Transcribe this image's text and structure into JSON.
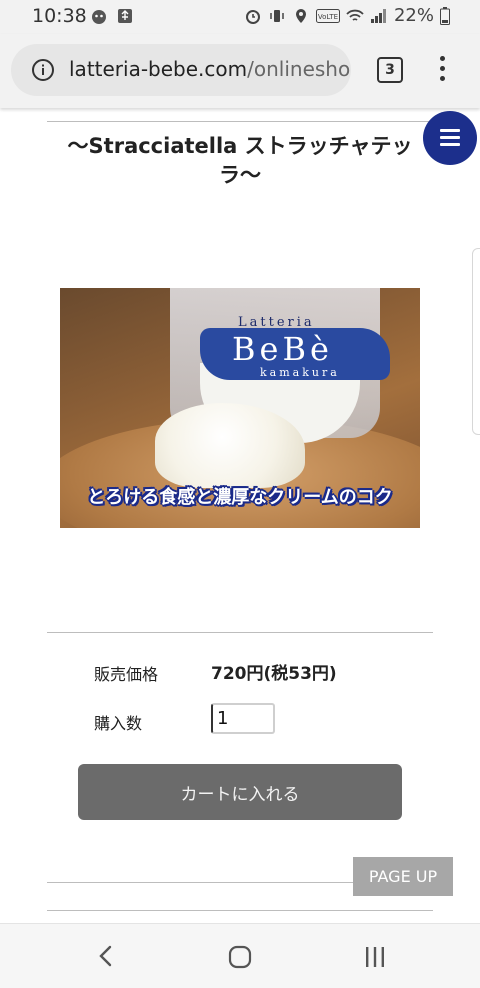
{
  "status_bar": {
    "time": "10:38",
    "battery": "22%",
    "icons": [
      "alarm-icon",
      "vibrate-icon",
      "location-icon",
      "volte-icon",
      "wifi-icon",
      "signal-icon",
      "battery-icon"
    ]
  },
  "browser": {
    "url_domain": "latteria-bebe.com",
    "url_path": "/onlineshop",
    "tab_count": "3"
  },
  "product": {
    "title": "〜Stracciatella ストラッチャテッラ〜",
    "image": {
      "brand_top": "Latteria",
      "brand_main": "BeBè",
      "brand_sub": "kamakura",
      "caption": "とろける食感と濃厚なクリームのコク"
    },
    "price_label": "販売価格",
    "price_value": "720円(税53円)",
    "qty_label": "購入数",
    "qty_value": "1",
    "cart_button": "カートに入れる"
  },
  "page_up": "PAGE UP",
  "colors": {
    "menu_fab": "#1c2f8c",
    "cart_button": "#6b6b6b",
    "page_up": "#a7a7a7"
  }
}
